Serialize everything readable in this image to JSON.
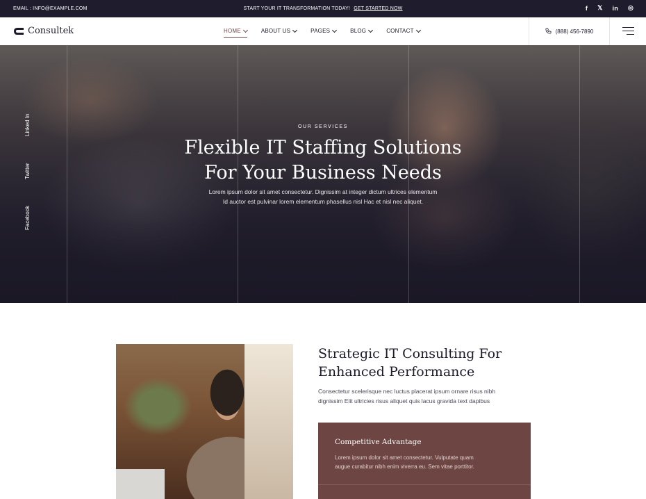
{
  "topbar": {
    "email": "EMAIL : INFO@EXAMPLE.COM",
    "promo_text": "START YOUR IT TRANSFORMATION TODAY!",
    "promo_link": "GET STARTED NOW",
    "socials": [
      "f",
      "𝕏",
      "in",
      "◎"
    ]
  },
  "header": {
    "logo": "Consultek",
    "nav": [
      {
        "label": "HOME"
      },
      {
        "label": "ABOUT US"
      },
      {
        "label": "PAGES"
      },
      {
        "label": "BLOG"
      },
      {
        "label": "CONTACT"
      }
    ],
    "phone": "(888) 456-7890"
  },
  "hero": {
    "side_social": [
      "Linked In",
      "Twitter",
      "Facebook"
    ],
    "kicker": "OUR SERVICES",
    "title_line1": "Flexible IT Staffing Solutions",
    "title_line2": "For Your Business Needs",
    "desc_line1": "Lorem ipsum dolor sit amet consectetur. Dignissim at integer dictum ultrices elementum",
    "desc_line2": "Id auctor est pulvinar lorem elementum phasellus nisl Hac et nisl nec aliquet."
  },
  "section": {
    "title_line1": "Strategic IT Consulting For",
    "title_line2": "Enhanced Performance",
    "desc_line1": "Consectetur scelerisque nec luctus placerat ipsum ornare risus nibh",
    "desc_line2": "dignissim Elit ultricies risus aliquet quis lacus gravida text dapibus",
    "card": {
      "title": "Competitive Advantage",
      "desc_line1": "Lorem ipsum dolor sit amet consectetur. Vulputate quam",
      "desc_line2": "augue curabitur nibh enim viverra eu. Sem vitae porttitor."
    }
  },
  "colors": {
    "topbar_bg": "#1f1c2e",
    "accent": "#6d4643",
    "text_dark": "#1d1b2b"
  }
}
